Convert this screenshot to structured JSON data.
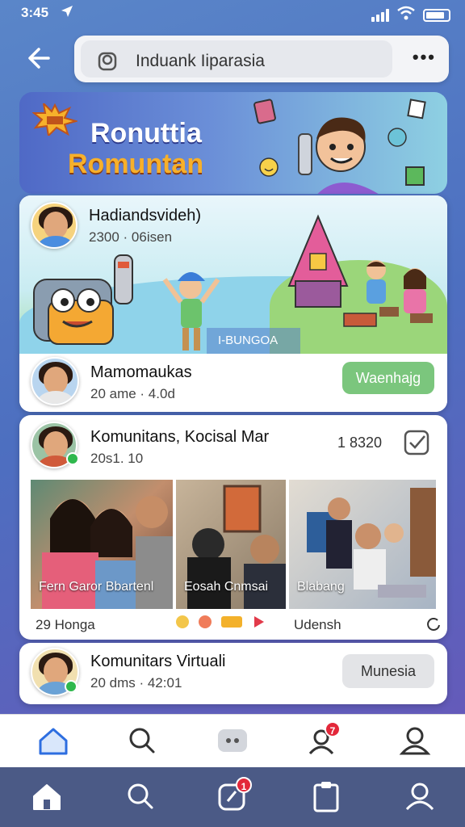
{
  "status_bar": {
    "time": "3:45"
  },
  "search": {
    "value": "Induank Iiparasia"
  },
  "banner": {
    "line1": "Ronuttia",
    "line2": "Romuntan"
  },
  "featured_card": {
    "title": "Hadiandsvideh)",
    "meta": "2300 · 06isen",
    "sign": "I-BUNGOA"
  },
  "card2": {
    "title": "Mamomaukas",
    "meta": "20 ame · 4.0d",
    "button": "Waenhajg"
  },
  "card3": {
    "title": "Komunitans, Kocisal Mar",
    "meta": "20s1. 10",
    "count": "1 8320",
    "photos": [
      {
        "caption": "Fern Garor Bbartenl"
      },
      {
        "caption": "Eosah Cnmsai"
      },
      {
        "caption": "Blabang"
      }
    ],
    "footer_left": "29 Honga",
    "footer_right": "Udensh"
  },
  "card4": {
    "title": "Komunitars Virtuali",
    "meta": "20 dms · 42:01",
    "button": "Munesia"
  },
  "nav": {
    "badge_count": "7",
    "badge_count_bottom": "1"
  },
  "colors": {
    "accent": "#2d6ee0",
    "green": "#7bc67d",
    "badge": "#e3283a"
  }
}
